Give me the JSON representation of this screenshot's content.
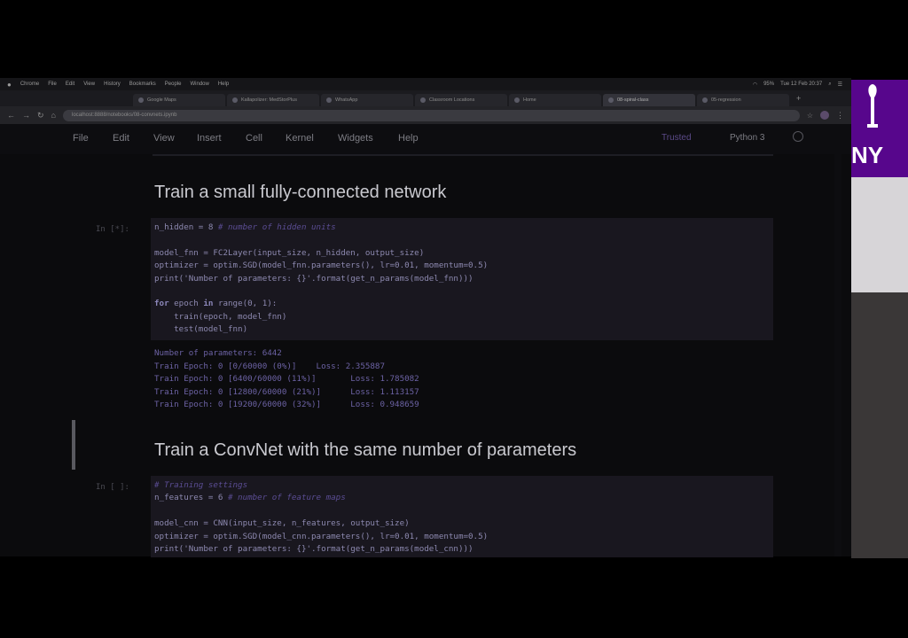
{
  "mac_menubar": {
    "app": "Chrome",
    "items": [
      "File",
      "Edit",
      "View",
      "History",
      "Bookmarks",
      "People",
      "Window",
      "Help"
    ],
    "battery": "95%",
    "datetime": "Tue 12 Feb 20:37"
  },
  "browser": {
    "tabs": [
      {
        "label": "Google Maps"
      },
      {
        "label": "Kallapolizer: MedStorPlus"
      },
      {
        "label": "WhatsApp"
      },
      {
        "label": "Classroom Locations"
      },
      {
        "label": "Home"
      },
      {
        "label": "08-spiral-class",
        "active": true
      },
      {
        "label": "05-regression"
      }
    ],
    "address": "localhost:8888/notebooks/08-convnets.ipynb"
  },
  "jupyter_menu": {
    "items": [
      "File",
      "Edit",
      "View",
      "Insert",
      "Cell",
      "Kernel",
      "Widgets",
      "Help"
    ],
    "trusted": "Trusted",
    "kernel": "Python 3"
  },
  "notebook": {
    "heading1": "Train a small fully-connected network",
    "cell1_prompt": "In [*]:",
    "cell1_lines": [
      [
        {
          "t": "n_hidden = 8 ",
          "c": "def"
        },
        {
          "t": "# number of hidden units",
          "c": "cmt"
        }
      ],
      [
        {
          "t": "",
          "c": "def"
        }
      ],
      [
        {
          "t": "model_fnn = FC2Layer(input_size, n_hidden, output_size)",
          "c": "def"
        }
      ],
      [
        {
          "t": "optimizer = optim.SGD(model_fnn.parameters(), lr=0.01, momentum=0.5)",
          "c": "def"
        }
      ],
      [
        {
          "t": "print('Number of parameters: {}'.format(get_n_params(model_fnn)))",
          "c": "def"
        }
      ],
      [
        {
          "t": "",
          "c": "def"
        }
      ],
      [
        {
          "t": "for",
          "c": "kw"
        },
        {
          "t": " epoch ",
          "c": "def"
        },
        {
          "t": "in",
          "c": "kw"
        },
        {
          "t": " range(0, 1):",
          "c": "def"
        }
      ],
      [
        {
          "t": "    train(epoch, model_fnn)",
          "c": "def"
        }
      ],
      [
        {
          "t": "    test(model_fnn)",
          "c": "def"
        }
      ]
    ],
    "output_lines": [
      "Number of parameters: 6442",
      "Train Epoch: 0 [0/60000 (0%)]    Loss: 2.355887",
      "Train Epoch: 0 [6400/60000 (11%)]       Loss: 1.785082",
      "Train Epoch: 0 [12800/60000 (21%)]      Loss: 1.113157",
      "Train Epoch: 0 [19200/60000 (32%)]      Loss: 0.948659"
    ],
    "heading2": "Train a ConvNet with the same number of parameters",
    "cell2_prompt": "In [ ]:",
    "cell2_lines": [
      [
        {
          "t": "# Training settings",
          "c": "cmt"
        }
      ],
      [
        {
          "t": "n_features = 6 ",
          "c": "def"
        },
        {
          "t": "# number of feature maps",
          "c": "cmt"
        }
      ],
      [
        {
          "t": "",
          "c": "def"
        }
      ],
      [
        {
          "t": "model_cnn = CNN(input_size, n_features, output_size)",
          "c": "def"
        }
      ],
      [
        {
          "t": "optimizer = optim.SGD(model_cnn.parameters(), lr=0.01, momentum=0.5)",
          "c": "def"
        }
      ],
      [
        {
          "t": "print('Number of parameters: {}'.format(get_n_params(model_cnn)))",
          "c": "def"
        }
      ]
    ]
  },
  "side_panel": {
    "logo_text": "NY"
  }
}
